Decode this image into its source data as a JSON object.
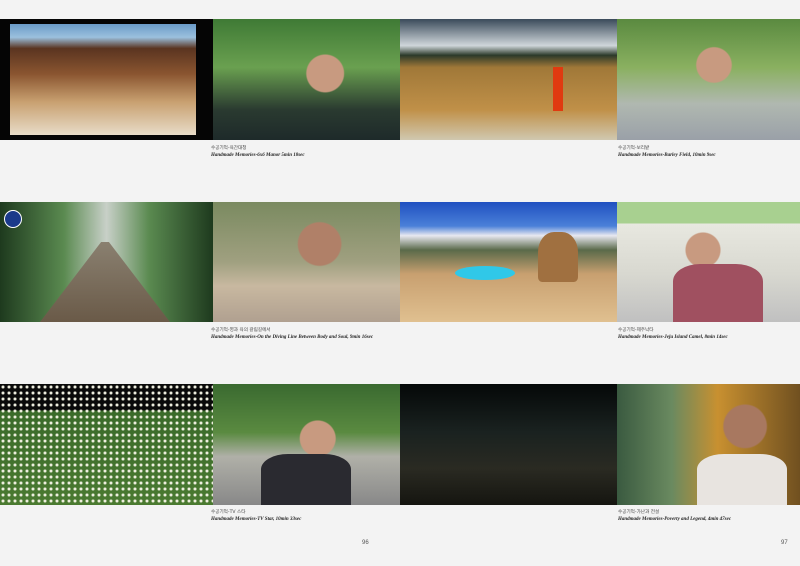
{
  "captions": [
    {
      "ko": "수공기억-육간대청",
      "en": "Handmade Memories-6x6 Manor 5min 18sec"
    },
    {
      "ko": "수공기억-보리밭",
      "en": "Handmade Memories-Barley Field, 10min 9sec"
    },
    {
      "ko": "수공기억-영과 육의 갈림길에서",
      "en": "Handmade Memories-On the Diving Line Between Body and Soul, 9min 16sec"
    },
    {
      "ko": "수공기억-제주낙타",
      "en": "Handmade Memories-Jeju Island Camel, 8min 14sec"
    },
    {
      "ko": "수공기억-TV 스타",
      "en": "Handmade Memories-TV Star, 10min 33sec"
    },
    {
      "ko": "수공기억-가난과 전설",
      "en": "Handmade Memories-Poverty and Legend, 4min 47sec"
    }
  ],
  "page_numbers": {
    "left": "96",
    "right": "97"
  }
}
